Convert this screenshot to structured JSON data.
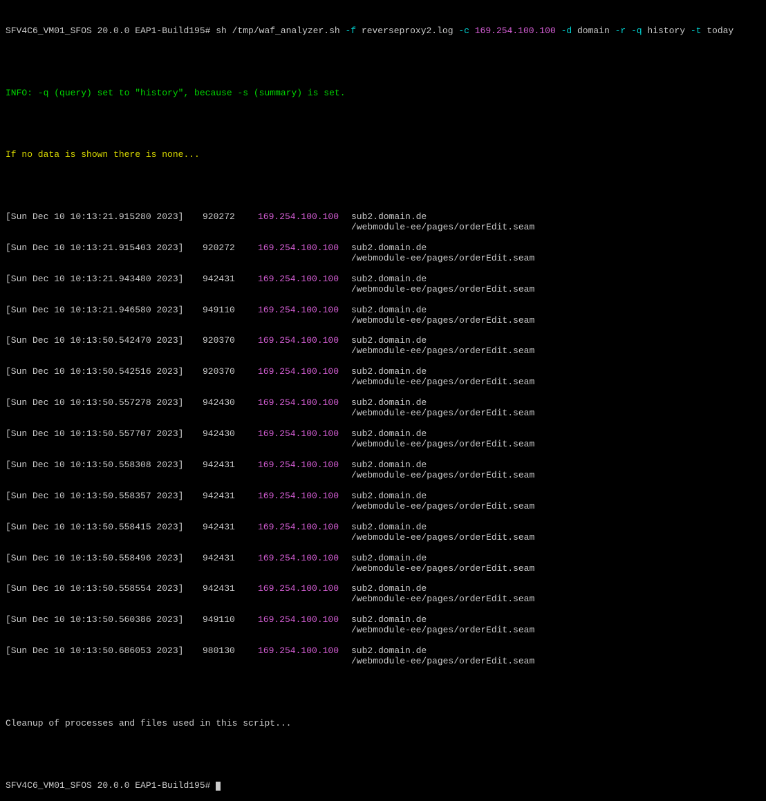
{
  "prompt": "SFV4C6_VM01_SFOS 20.0.0 EAP1-Build195#",
  "cmd": {
    "base": " sh /tmp/waf_analyzer.sh",
    "fFlag": " -f",
    "fVal": " reverseproxy2.log",
    "cFlag": " -c",
    "cVal": " 169.254.100.100",
    "dFlag": " -d",
    "dVal": " domain",
    "rFlag": " -r",
    "qFlag": " -q",
    "qVal": " history",
    "tFlag": " -t",
    "tVal": " today"
  },
  "info": {
    "label": "INFO:",
    "text": " -q (query) set to \"history\", because -s (summary) is set."
  },
  "noDataMsg": "If no data is shown there is none...",
  "entries": [
    {
      "ts": "[Sun Dec 10 10:13:21.915280 2023]",
      "id": "920272",
      "ip": "169.254.100.100",
      "domain": "sub2.domain.de",
      "path": "/webmodule-ee/pages/orderEdit.seam"
    },
    {
      "ts": "[Sun Dec 10 10:13:21.915403 2023]",
      "id": "920272",
      "ip": "169.254.100.100",
      "domain": "sub2.domain.de",
      "path": "/webmodule-ee/pages/orderEdit.seam"
    },
    {
      "ts": "[Sun Dec 10 10:13:21.943480 2023]",
      "id": "942431",
      "ip": "169.254.100.100",
      "domain": "sub2.domain.de",
      "path": "/webmodule-ee/pages/orderEdit.seam"
    },
    {
      "ts": "[Sun Dec 10 10:13:21.946580 2023]",
      "id": "949110",
      "ip": "169.254.100.100",
      "domain": "sub2.domain.de",
      "path": "/webmodule-ee/pages/orderEdit.seam"
    },
    {
      "ts": "[Sun Dec 10 10:13:50.542470 2023]",
      "id": "920370",
      "ip": "169.254.100.100",
      "domain": "sub2.domain.de",
      "path": "/webmodule-ee/pages/orderEdit.seam"
    },
    {
      "ts": "[Sun Dec 10 10:13:50.542516 2023]",
      "id": "920370",
      "ip": "169.254.100.100",
      "domain": "sub2.domain.de",
      "path": "/webmodule-ee/pages/orderEdit.seam"
    },
    {
      "ts": "[Sun Dec 10 10:13:50.557278 2023]",
      "id": "942430",
      "ip": "169.254.100.100",
      "domain": "sub2.domain.de",
      "path": "/webmodule-ee/pages/orderEdit.seam"
    },
    {
      "ts": "[Sun Dec 10 10:13:50.557707 2023]",
      "id": "942430",
      "ip": "169.254.100.100",
      "domain": "sub2.domain.de",
      "path": "/webmodule-ee/pages/orderEdit.seam"
    },
    {
      "ts": "[Sun Dec 10 10:13:50.558308 2023]",
      "id": "942431",
      "ip": "169.254.100.100",
      "domain": "sub2.domain.de",
      "path": "/webmodule-ee/pages/orderEdit.seam"
    },
    {
      "ts": "[Sun Dec 10 10:13:50.558357 2023]",
      "id": "942431",
      "ip": "169.254.100.100",
      "domain": "sub2.domain.de",
      "path": "/webmodule-ee/pages/orderEdit.seam"
    },
    {
      "ts": "[Sun Dec 10 10:13:50.558415 2023]",
      "id": "942431",
      "ip": "169.254.100.100",
      "domain": "sub2.domain.de",
      "path": "/webmodule-ee/pages/orderEdit.seam"
    },
    {
      "ts": "[Sun Dec 10 10:13:50.558496 2023]",
      "id": "942431",
      "ip": "169.254.100.100",
      "domain": "sub2.domain.de",
      "path": "/webmodule-ee/pages/orderEdit.seam"
    },
    {
      "ts": "[Sun Dec 10 10:13:50.558554 2023]",
      "id": "942431",
      "ip": "169.254.100.100",
      "domain": "sub2.domain.de",
      "path": "/webmodule-ee/pages/orderEdit.seam"
    },
    {
      "ts": "[Sun Dec 10 10:13:50.560386 2023]",
      "id": "949110",
      "ip": "169.254.100.100",
      "domain": "sub2.domain.de",
      "path": "/webmodule-ee/pages/orderEdit.seam"
    },
    {
      "ts": "[Sun Dec 10 10:13:50.686053 2023]",
      "id": "980130",
      "ip": "169.254.100.100",
      "domain": "sub2.domain.de",
      "path": "/webmodule-ee/pages/orderEdit.seam"
    }
  ],
  "cleanup": "Cleanup of processes and files used in this script...",
  "prompt2": "SFV4C6_VM01_SFOS 20.0.0 EAP1-Build195# "
}
